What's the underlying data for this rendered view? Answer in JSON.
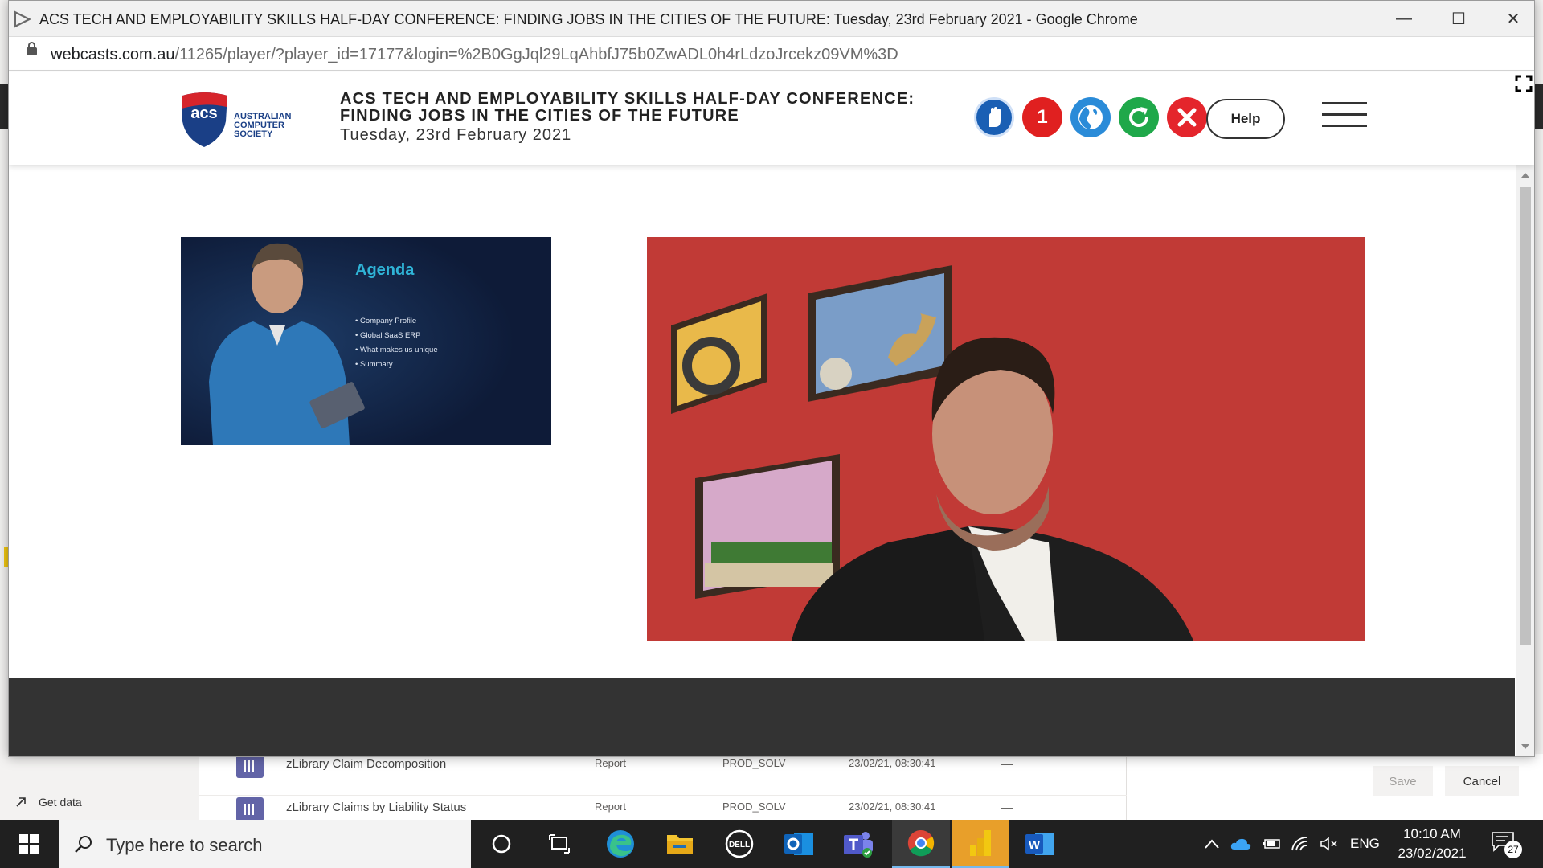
{
  "browser": {
    "window_title": "ACS TECH AND EMPLOYABILITY SKILLS HALF-DAY CONFERENCE: FINDING JOBS IN THE CITIES OF THE FUTURE: Tuesday, 23rd February 2021 - Google Chrome",
    "url_domain": "webcasts.com.au",
    "url_path": "/11265/player/?player_id=17177&login=%2B0GgJql29LqAhbfJ75b0ZwADL0h4rLdzoJrcekz09VM%3D",
    "buttons": {
      "minimize": "—",
      "maximize": "☐",
      "close": "✕"
    }
  },
  "header": {
    "logo_mark": "acs",
    "logo_text": [
      "AUSTRALIAN",
      "COMPUTER",
      "SOCIETY"
    ],
    "title_line1": "ACS TECH AND EMPLOYABILITY SKILLS HALF-DAY CONFERENCE:",
    "title_line2": "FINDING JOBS IN THE CITIES OF THE FUTURE",
    "date": "Tuesday, 23rd February 2021",
    "icons": [
      {
        "name": "raise-hand-icon",
        "color": "#1a5fb4"
      },
      {
        "name": "number-badge-icon",
        "color": "#e02020",
        "label": "1"
      },
      {
        "name": "globe-icon",
        "color": "#2a8bd8"
      },
      {
        "name": "refresh-icon",
        "color": "#1fa84a"
      },
      {
        "name": "close-circle-icon",
        "color": "#e4252c"
      }
    ],
    "help_label": "Help"
  },
  "slide": {
    "title": "Agenda",
    "items": [
      "Company Profile",
      "Global SaaS ERP",
      "What makes us unique",
      "Summary"
    ]
  },
  "background_app": {
    "get_data_label": "Get data",
    "rows": [
      {
        "name": "zLibrary Claim Decomposition",
        "type": "Report",
        "owner": "PROD_SOLV",
        "date": "23/02/21, 08:30:41",
        "dash": "—"
      },
      {
        "name": "zLibrary Claims by Liability Status",
        "type": "Report",
        "owner": "PROD_SOLV",
        "date": "23/02/21, 08:30:41",
        "dash": "—"
      }
    ],
    "save_label": "Save",
    "cancel_label": "Cancel"
  },
  "taskbar": {
    "search_placeholder": "Type here to search",
    "language": "ENG",
    "time": "10:10 AM",
    "date": "23/02/2021",
    "notification_count": "27",
    "pinned": [
      "cortana-icon",
      "task-view-icon",
      "edge-icon",
      "file-explorer-icon",
      "dell-icon",
      "outlook-icon",
      "teams-icon",
      "chrome-icon",
      "powerbi-icon",
      "word-icon"
    ]
  }
}
